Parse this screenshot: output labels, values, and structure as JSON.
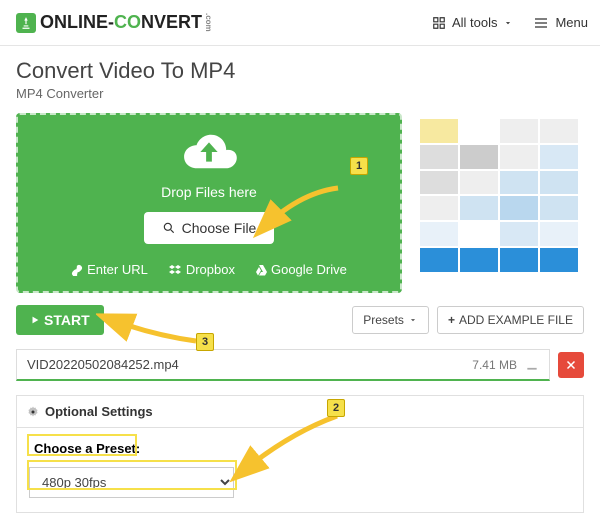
{
  "header": {
    "brand_part1": "ONLINE-",
    "brand_part2": "CO",
    "brand_part3": "NVERT",
    "brand_suffix": ".com",
    "all_tools": "All tools",
    "menu": "Menu"
  },
  "page": {
    "title": "Convert Video To MP4",
    "subtitle": "MP4 Converter"
  },
  "drop": {
    "text": "Drop Files here",
    "choose": "Choose File",
    "enter_url": "Enter URL",
    "dropbox": "Dropbox",
    "gdrive": "Google Drive"
  },
  "actions": {
    "start": "START",
    "presets": "Presets",
    "add_example": "ADD EXAMPLE FILE"
  },
  "file": {
    "name": "VID20220502084252.mp4",
    "size": "7.41 MB"
  },
  "settings": {
    "header": "Optional Settings",
    "preset_label": "Choose a Preset:",
    "preset_value": "480p 30fps"
  },
  "annotations": {
    "a1": "1",
    "a2": "2",
    "a3": "3"
  }
}
